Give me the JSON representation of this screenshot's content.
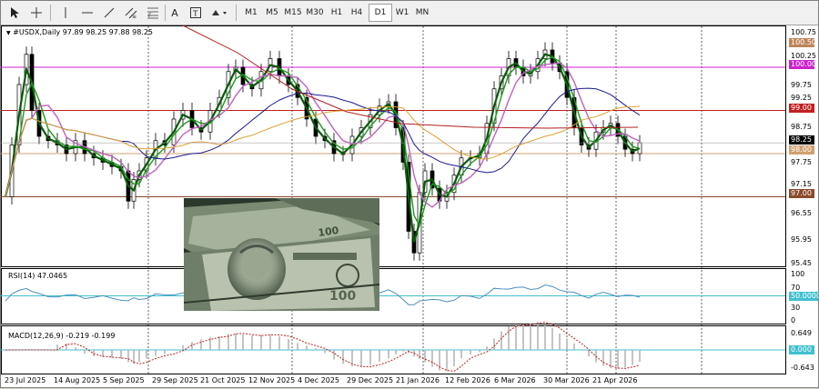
{
  "toolbar": {
    "timeframes": [
      "M1",
      "M5",
      "M15",
      "M30",
      "H1",
      "H4",
      "D1",
      "W1",
      "MN"
    ]
  },
  "main_chart": {
    "header": "#USDX,Daily  97.89 98.25 97.88 98.25",
    "price_scale": [
      "100.75",
      "100.25",
      "99.75",
      "99.25",
      "98.75",
      "98.25",
      "97.75",
      "97.15",
      "96.55",
      "95.95",
      "95.45"
    ],
    "levels": [
      {
        "value": "100.50",
        "color": "#c0845a",
        "kind": "right-badge"
      },
      {
        "value": "100.00",
        "color": "#cc22cc",
        "kind": "line"
      },
      {
        "value": "99.00",
        "color": "#c02020",
        "kind": "line"
      },
      {
        "value": "98.25",
        "color": "#000000",
        "kind": "current"
      },
      {
        "value": "98.00",
        "color": "#d0a070",
        "kind": "line"
      },
      {
        "value": "97.00",
        "color": "#8b4a2a",
        "kind": "line"
      }
    ],
    "image_overlay": "us-dollar-banknotes-photo"
  },
  "rsi": {
    "header": "RSI(14) 47.0465",
    "scale": [
      "100",
      "70",
      "50.0000",
      "30",
      "0"
    ]
  },
  "macd": {
    "header": "MACD(12,26,9) -0.219 -0.199",
    "scale": [
      "0.649",
      "0.000",
      "-0.643"
    ]
  },
  "time_axis": [
    "23 Jul 2025",
    "14 Aug 2025",
    "5 Sep 2025",
    "29 Sep 2025",
    "21 Oct 2025",
    "12 Nov 2025",
    "4 Dec 2025",
    "29 Dec 2025",
    "21 Jan 2026",
    "12 Feb 2026",
    "6 Mar 2026",
    "30 Mar 2026",
    "21 Apr 2026"
  ],
  "colors": {
    "ma_green": "#1a9a1a",
    "ma_magenta": "#c060c0",
    "ma_blue": "#1a1a90",
    "ma_orange": "#e0a030",
    "ma_red": "#b02020",
    "rsi_line": "#4a90c0",
    "macd_line": "#c02020",
    "macd_hist": "#b0b0b0",
    "cyan_level": "#40c0d0"
  }
}
